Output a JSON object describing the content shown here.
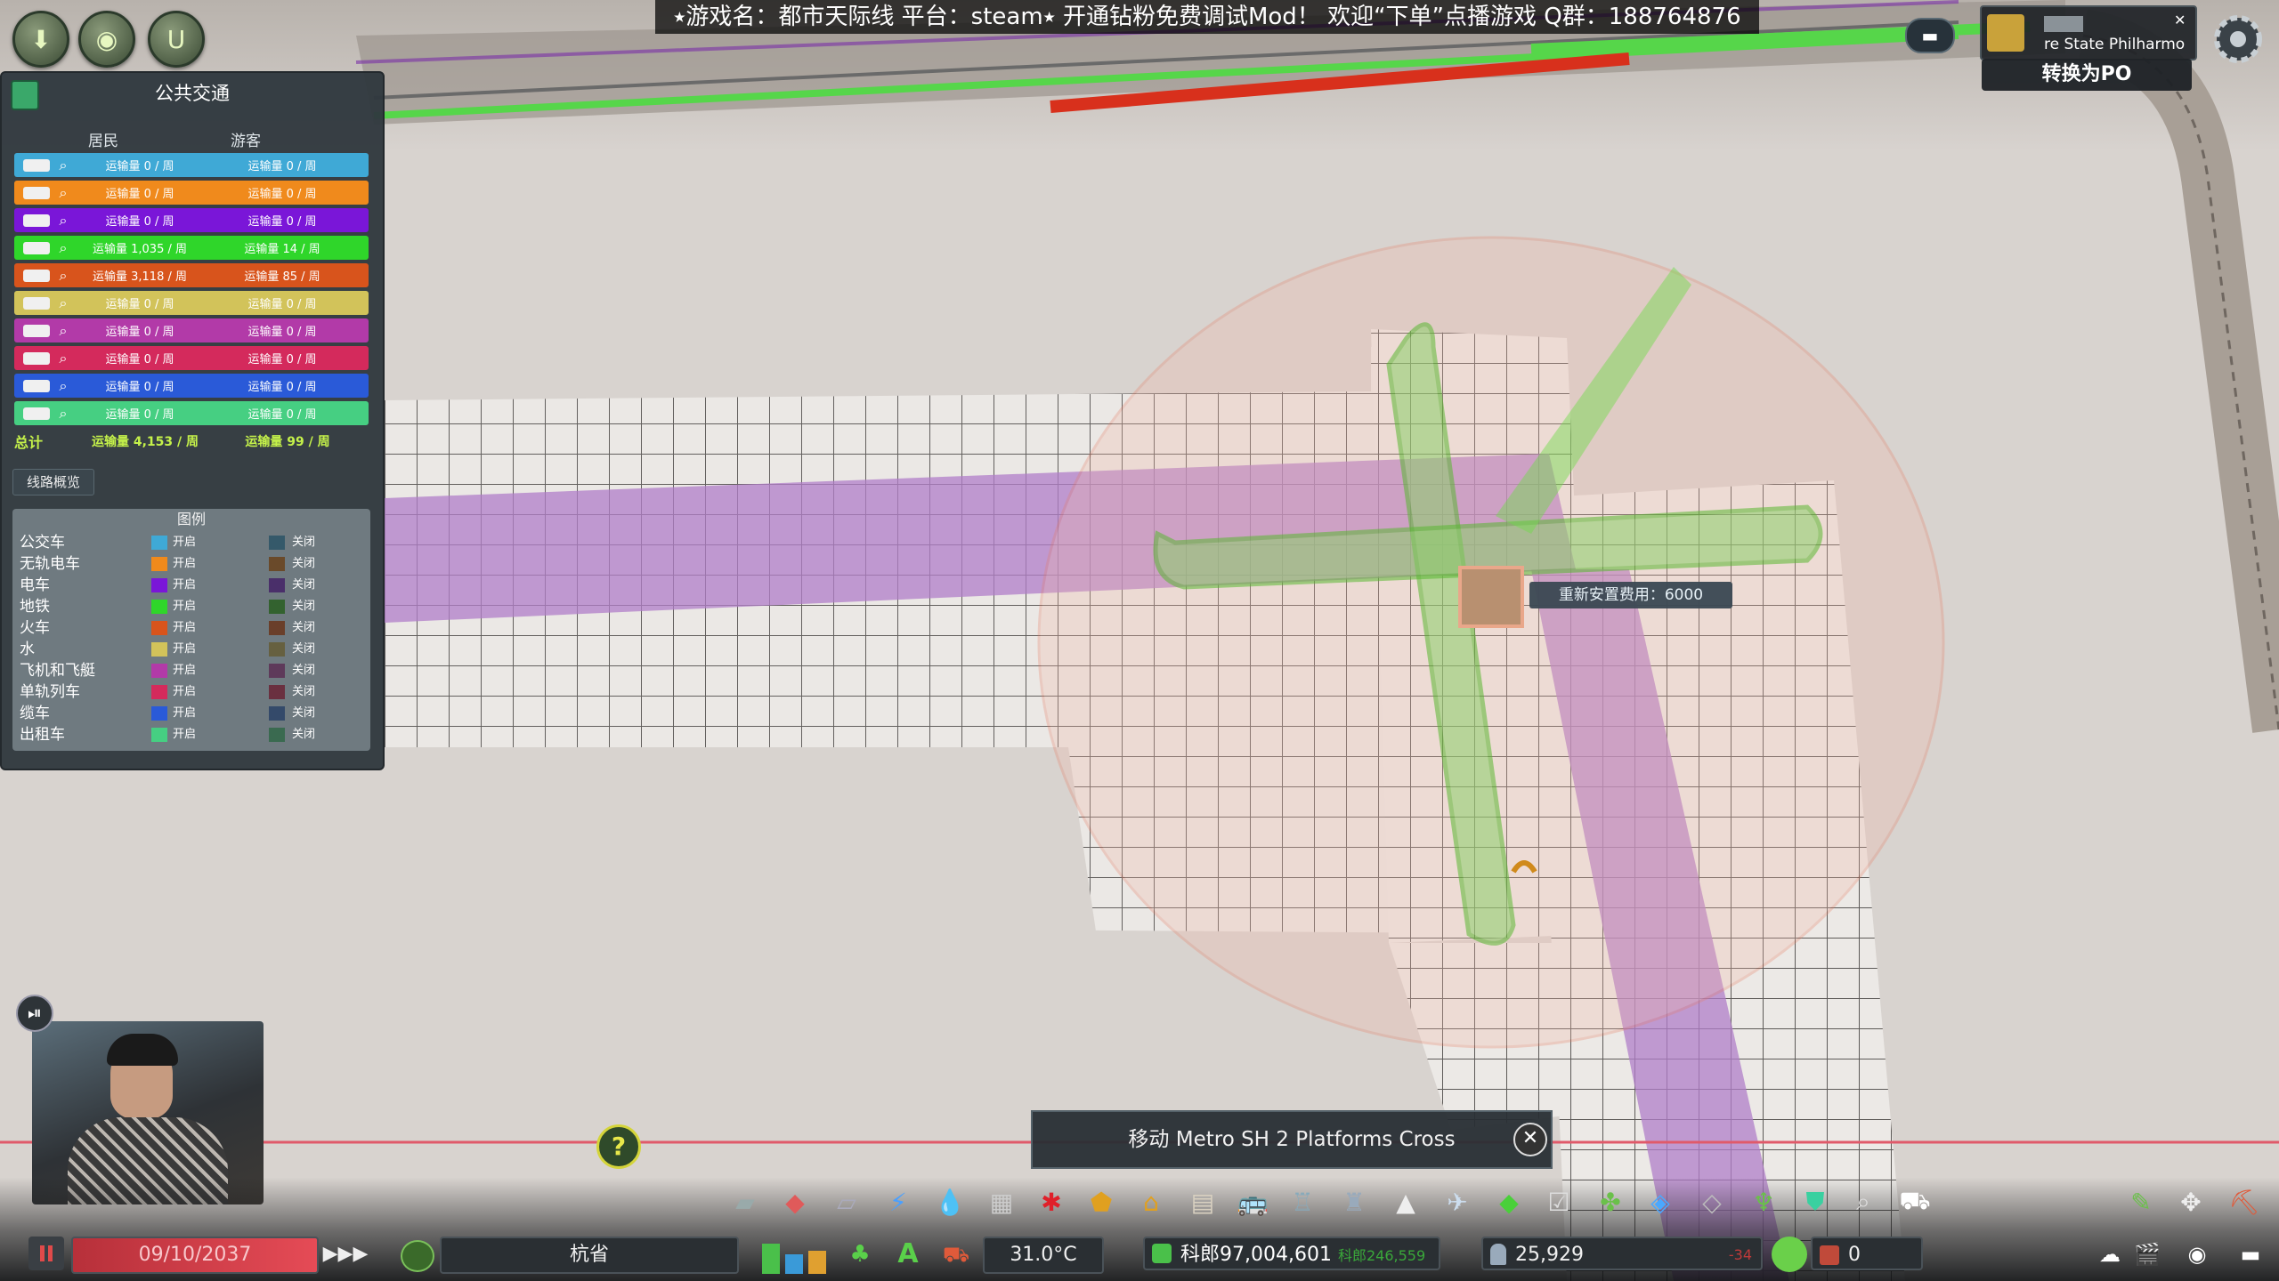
{
  "banner": {
    "text": "⭑游戏名：都市天际线 平台：steam⭑ 开通钻粉免费调试Mod！ 欢迎“下单”点播游戏  Q群：188764876"
  },
  "top_left": {
    "unlock_label": "U"
  },
  "panel": {
    "title": "公共交通",
    "col_residents": "居民",
    "col_tourists": "游客",
    "rows": [
      {
        "color": "#3fa9d6",
        "residents": "运输量 0 / 周",
        "tourists": "运输量 0 / 周"
      },
      {
        "color": "#f08a1c",
        "residents": "运输量 0 / 周",
        "tourists": "运输量 0 / 周"
      },
      {
        "color": "#7a16d8",
        "residents": "运输量 0 / 周",
        "tourists": "运输量 0 / 周"
      },
      {
        "color": "#2fd62a",
        "residents": "运输量 1,035 / 周",
        "tourists": "运输量 14 / 周"
      },
      {
        "color": "#d8541c",
        "residents": "运输量 3,118 / 周",
        "tourists": "运输量 85 / 周"
      },
      {
        "color": "#d2c35a",
        "residents": "运输量 0 / 周",
        "tourists": "运输量 0 / 周"
      },
      {
        "color": "#b23aa8",
        "residents": "运输量 0 / 周",
        "tourists": "运输量 0 / 周"
      },
      {
        "color": "#d42a5c",
        "residents": "运输量 0 / 周",
        "tourists": "运输量 0 / 周"
      },
      {
        "color": "#2a5ad8",
        "residents": "运输量 0 / 周",
        "tourists": "运输量 0 / 周"
      },
      {
        "color": "#46cf82",
        "residents": "运输量 0 / 周",
        "tourists": "运输量 0 / 周"
      }
    ],
    "total_label": "总计",
    "total_residents": "运输量 4,153 / 周",
    "total_tourists": "运输量 99 / 周",
    "route_overview": "线路概览",
    "legend_title": "图例",
    "legend": [
      {
        "name": "公交车",
        "on_color": "#3fa9d6",
        "off_color": "#35596a",
        "on": "开启",
        "off": "关闭"
      },
      {
        "name": "无轨电车",
        "on_color": "#f08a1c",
        "off_color": "#6a4a2a",
        "on": "开启",
        "off": "关闭"
      },
      {
        "name": "电车",
        "on_color": "#7a16d8",
        "off_color": "#4a2f6a",
        "on": "开启",
        "off": "关闭"
      },
      {
        "name": "地铁",
        "on_color": "#2fd62a",
        "off_color": "#33622f",
        "on": "开启",
        "off": "关闭"
      },
      {
        "name": "火车",
        "on_color": "#d8541c",
        "off_color": "#6a3f2a",
        "on": "开启",
        "off": "关闭"
      },
      {
        "name": "水",
        "on_color": "#d2c35a",
        "off_color": "#666040",
        "on": "开启",
        "off": "关闭"
      },
      {
        "name": "飞机和飞艇",
        "on_color": "#b23aa8",
        "off_color": "#5e3a5a",
        "on": "开启",
        "off": "关闭"
      },
      {
        "name": "单轨列车",
        "on_color": "#d42a5c",
        "off_color": "#6a3040",
        "on": "开启",
        "off": "关闭"
      },
      {
        "name": "缆车",
        "on_color": "#2a5ad8",
        "off_color": "#344a6a",
        "on": "开启",
        "off": "关闭"
      },
      {
        "name": "出租车",
        "on_color": "#46cf82",
        "off_color": "#3a6a50",
        "on": "开启",
        "off": "关闭"
      }
    ]
  },
  "map": {
    "relocate_cost": "重新安置费用：6000"
  },
  "move_banner": {
    "text": "移动 Metro SH 2 Platforms Cross"
  },
  "top_right": {
    "info_title": "re State Philharmo",
    "convert": "转换为PO"
  },
  "bottom": {
    "date": "09/10/2037",
    "city": "杭省",
    "temperature": "31.0°C",
    "money": "科郎97,004,601",
    "income": "科郎246,559",
    "population": "25,929",
    "pop_change": "-34",
    "happiness": "0"
  }
}
